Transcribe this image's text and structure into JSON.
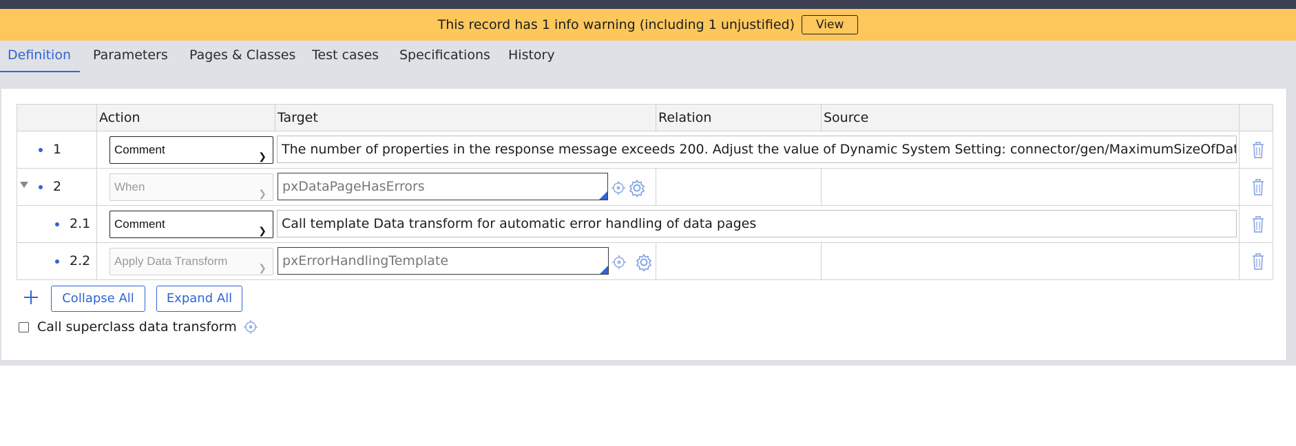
{
  "warning": {
    "message": "This record has 1 info warning (including 1 unjustified)",
    "view_label": "View"
  },
  "tabs": [
    {
      "label": "Definition",
      "active": true
    },
    {
      "label": "Parameters",
      "active": false
    },
    {
      "label": "Pages & Classes",
      "active": false
    },
    {
      "label": "Test cases",
      "active": false
    },
    {
      "label": "Specifications",
      "active": false
    },
    {
      "label": "History",
      "active": false
    }
  ],
  "table": {
    "headers": {
      "action": "Action",
      "target": "Target",
      "relation": "Relation",
      "source": "Source"
    },
    "rows": [
      {
        "num": "1",
        "action": "Comment",
        "target": "The number of properties in the response message exceeds 200. Adjust the value of Dynamic System Setting: connector/gen/MaximumSizeOfDataTransform"
      },
      {
        "num": "2",
        "action": "When",
        "target": "pxDataPageHasErrors",
        "expanded": true
      },
      {
        "num": "2.1",
        "action": "Comment",
        "target": "Call template Data transform for automatic error handling of data pages"
      },
      {
        "num": "2.2",
        "action": "Apply Data Transform",
        "target": "pxErrorHandlingTemplate"
      }
    ]
  },
  "buttons": {
    "collapse_all": "Collapse All",
    "expand_all": "Expand All"
  },
  "options": {
    "call_superclass_label": "Call superclass data transform",
    "call_superclass_checked": false
  },
  "icons": {
    "add": "plus-icon",
    "delete": "trash-icon",
    "target": "crosshair-icon",
    "settings": "gear-icon"
  },
  "colors": {
    "accent": "#2f64d4",
    "warning_bg": "#fec75c",
    "header_bar": "#3c4152"
  }
}
